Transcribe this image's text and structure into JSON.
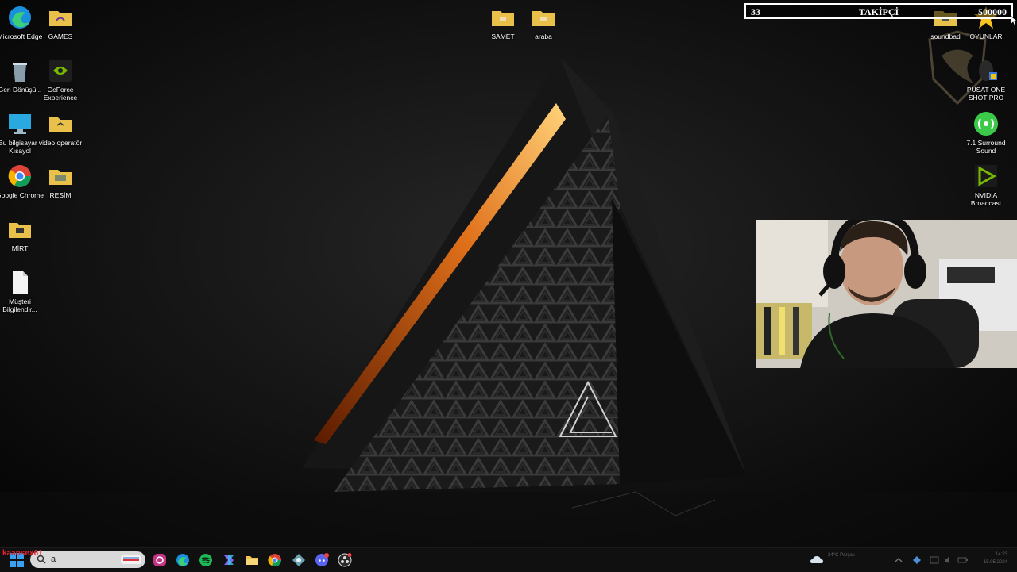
{
  "desktop_icons_left": [
    {
      "label": "Microsoft Edge",
      "icon": "edge-icon"
    },
    {
      "label": "GAMES",
      "icon": "folder-icon"
    },
    {
      "label": "Geri Dönüşü...",
      "icon": "recycle-bin-icon"
    },
    {
      "label": "GeForce Experience",
      "icon": "geforce-icon"
    },
    {
      "label": "Bu bilgisayar - Kısayol",
      "icon": "this-pc-icon"
    },
    {
      "label": "video operatör",
      "icon": "folder-icon"
    },
    {
      "label": "Google Chrome",
      "icon": "chrome-icon"
    },
    {
      "label": "RESİM",
      "icon": "folder-icon"
    },
    {
      "label": "MİRT",
      "icon": "folder-icon"
    },
    {
      "label": "Müşteri Bilgilendir...",
      "icon": "document-icon"
    }
  ],
  "desktop_icons_top": [
    {
      "label": "SAMET",
      "icon": "folder-icon"
    },
    {
      "label": "araba",
      "icon": "folder-icon"
    }
  ],
  "desktop_icons_right": [
    {
      "label": "soundbad",
      "icon": "folder-icon"
    },
    {
      "label": "OYUNLAR",
      "icon": "star-icon"
    },
    {
      "label": "PUSAT ONE SHOT PRO",
      "icon": "mouse-app-icon"
    },
    {
      "label": "7.1 Surround Sound",
      "icon": "surround-sound-icon"
    },
    {
      "label": "NVIDIA Broadcast",
      "icon": "nvidia-broadcast-icon"
    }
  ],
  "follower_overlay": {
    "current": "33",
    "label": "TAKİPÇİ",
    "goal": "500000"
  },
  "taskbar": {
    "search_text": "a",
    "streamer_tag": "kaansex61",
    "tray_weather": "24°C Parçalı",
    "tray_time": "14:23",
    "tray_date": "15.05.2024"
  },
  "colors": {
    "folder": "#e8c04a",
    "accent_red": "#e0232c",
    "taskbar": "#101010"
  }
}
